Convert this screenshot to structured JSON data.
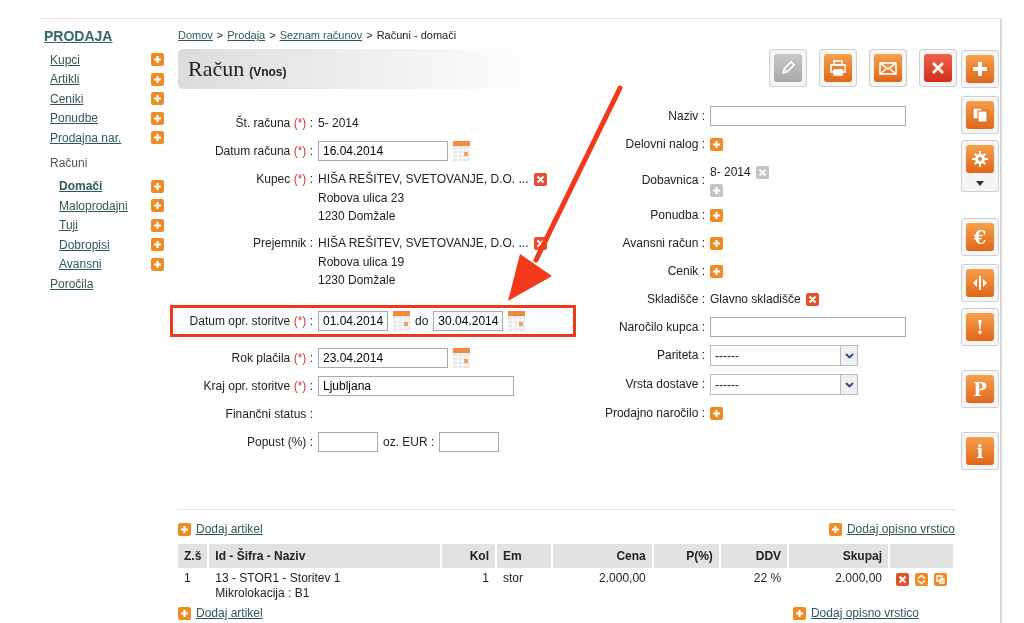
{
  "sidebar": {
    "title": "PRODAJA",
    "items": [
      {
        "label": "Kupci",
        "kind": "link",
        "has_add": true,
        "selected": false
      },
      {
        "label": "Artikli",
        "kind": "link",
        "has_add": true,
        "selected": false
      },
      {
        "label": "Ceniki",
        "kind": "link",
        "has_add": true,
        "selected": false
      },
      {
        "label": "Ponudbe",
        "kind": "link",
        "has_add": true,
        "selected": false
      },
      {
        "label": "Prodajna nar.",
        "kind": "link",
        "has_add": true,
        "selected": false
      },
      {
        "label": "Računi",
        "kind": "group",
        "children": [
          {
            "label": "Domači",
            "kind": "link",
            "has_add": true,
            "selected": true
          },
          {
            "label": "Maloprodajni",
            "kind": "link",
            "has_add": true,
            "selected": false
          },
          {
            "label": "Tuji",
            "kind": "link",
            "has_add": true,
            "selected": false
          },
          {
            "label": "Dobropisi",
            "kind": "link",
            "has_add": true,
            "selected": false
          },
          {
            "label": "Avansni",
            "kind": "link",
            "has_add": true,
            "selected": false
          }
        ]
      },
      {
        "label": "Poročila",
        "kind": "link",
        "has_add": false,
        "selected": false
      }
    ]
  },
  "breadcrumb": [
    {
      "label": "Domov",
      "kind": "link"
    },
    {
      "label": ">",
      "kind": "sep"
    },
    {
      "label": "Prodaja",
      "kind": "link"
    },
    {
      "label": ">",
      "kind": "sep"
    },
    {
      "label": "Seznam računov",
      "kind": "link"
    },
    {
      "label": ">",
      "kind": "sep"
    },
    {
      "label": "Računi - domači",
      "kind": "current"
    }
  ],
  "header": {
    "title": "Račun",
    "subtitle": "(Vnos)"
  },
  "toolbar": [
    {
      "kind": "edit",
      "disabled": true
    },
    {
      "kind": "print",
      "disabled": false
    },
    {
      "kind": "mail",
      "disabled": false
    },
    {
      "kind": "delete",
      "disabled": false
    }
  ],
  "side_buttons": [
    {
      "kind": "add"
    },
    {
      "kind": "copy"
    },
    {
      "kind": "settings_menu"
    },
    {
      "kind": "glyph",
      "glyph": "€"
    },
    {
      "kind": "split"
    },
    {
      "kind": "glyph",
      "glyph": "!"
    },
    {
      "kind": "glyph",
      "glyph": "P"
    },
    {
      "kind": "glyph",
      "glyph": "i"
    }
  ],
  "left_form": [
    {
      "label": "Št. računa",
      "marker": "(*)",
      "colon": ":",
      "kind": "text",
      "value": "5- 2014"
    },
    {
      "label": "Datum računa",
      "marker": "(*)",
      "colon": ":",
      "kind": "date",
      "value": "16.04.2014"
    },
    {
      "label": "Kupec",
      "marker": "(*)",
      "colon": ":",
      "kind": "address",
      "lines": [
        "HIŠA REŠITEV, SVETOVANJE, D.O. ...",
        "Robova ulica 23",
        "1230 Domžale"
      ]
    },
    {
      "label": "Prejemnik",
      "colon": ":",
      "kind": "address",
      "lines": [
        "HIŠA REŠITEV, SVETOVANJE, D.O. ...",
        "Robova ulica 19",
        "1230 Domžale"
      ]
    },
    {
      "label": "Datum opr. storitve",
      "marker": "(*)",
      "colon": ":",
      "kind": "date_range",
      "from": "01.04.2014",
      "separator": "do",
      "to": "30.04.2014",
      "highlighted": true
    },
    {
      "label": "Rok plačila",
      "marker": "(*)",
      "colon": ":",
      "kind": "date",
      "value": "23.04.2014"
    },
    {
      "label": "Kraj opr. storitve",
      "marker": "(*)",
      "colon": ":",
      "kind": "input",
      "value": "Ljubljana"
    },
    {
      "label": "Finančni status",
      "colon": ":",
      "kind": "text"
    },
    {
      "label": "Popust (%)",
      "colon": ":",
      "kind": "discount",
      "second_label": "oz. EUR :"
    }
  ],
  "right_form": [
    {
      "label": "Naziv :",
      "kind": "input"
    },
    {
      "label": "Delovni nalog :",
      "kind": "add"
    },
    {
      "label": "Dobavnica :",
      "kind": "document",
      "value": "8- 2014",
      "add_disabled": true
    },
    {
      "label": "Ponudba :",
      "kind": "add"
    },
    {
      "label": "Avansni račun :",
      "kind": "add"
    },
    {
      "label": "Cenik :",
      "kind": "add"
    },
    {
      "label": "Skladišče :",
      "kind": "text_remove",
      "value": "Glavno skladišče"
    },
    {
      "label": "Naročilo kupca :",
      "kind": "input"
    },
    {
      "label": "Pariteta :",
      "kind": "select",
      "value": "------"
    },
    {
      "label": "Vrsta dostave :",
      "kind": "select",
      "value": "------"
    },
    {
      "label": "Prodajno naročilo :",
      "kind": "add"
    }
  ],
  "items": {
    "top_links": [
      "Dodaj artikel",
      "Dodaj opisno vrstico"
    ],
    "columns": [
      "Z.š",
      "Id - Šifra - Naziv",
      "Kol",
      "Em",
      "Cena",
      "P(%)",
      "DDV",
      "Skupaj"
    ],
    "rows": [
      {
        "cells": [
          "1",
          [
            "13 - STOR1 - Storitev 1",
            "Mikrolokacija : B1"
          ],
          "1",
          "stor",
          "2.000,00",
          "",
          "22 %",
          "2.000,00"
        ]
      }
    ],
    "bottom_links": [
      "Dodaj artikel",
      "Dodaj opisno vrstico"
    ]
  }
}
